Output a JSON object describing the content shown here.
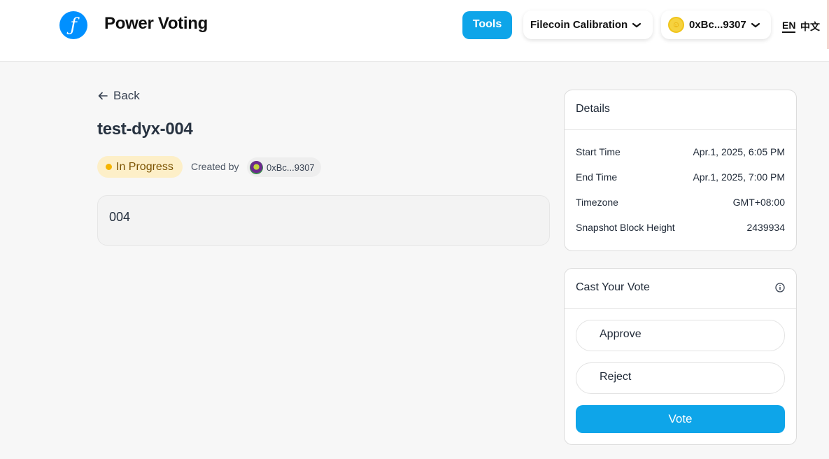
{
  "header": {
    "brand": "Power Voting",
    "tools_label": "Tools",
    "network_label": "Filecoin Calibration",
    "wallet_label": "0xBc...9307",
    "lang_en": "EN",
    "lang_zh": "中文"
  },
  "proposal": {
    "back_label": "Back",
    "title": "test-dyx-004",
    "status": "In Progress",
    "created_by_label": "Created by",
    "creator": "0xBc...9307",
    "description": "004"
  },
  "details": {
    "heading": "Details",
    "rows": [
      {
        "label": "Start Time",
        "value": "Apr.1, 2025, 6:05 PM"
      },
      {
        "label": "End Time",
        "value": "Apr.1, 2025, 7:00 PM"
      },
      {
        "label": "Timezone",
        "value": "GMT+08:00"
      },
      {
        "label": "Snapshot Block Height",
        "value": "2439934"
      }
    ]
  },
  "vote": {
    "heading": "Cast Your Vote",
    "options": [
      "Approve",
      "Reject"
    ],
    "submit_label": "Vote"
  },
  "colors": {
    "accent": "#0ea5e9",
    "status_bg": "#fdefc8",
    "status_dot": "#f5b400"
  }
}
